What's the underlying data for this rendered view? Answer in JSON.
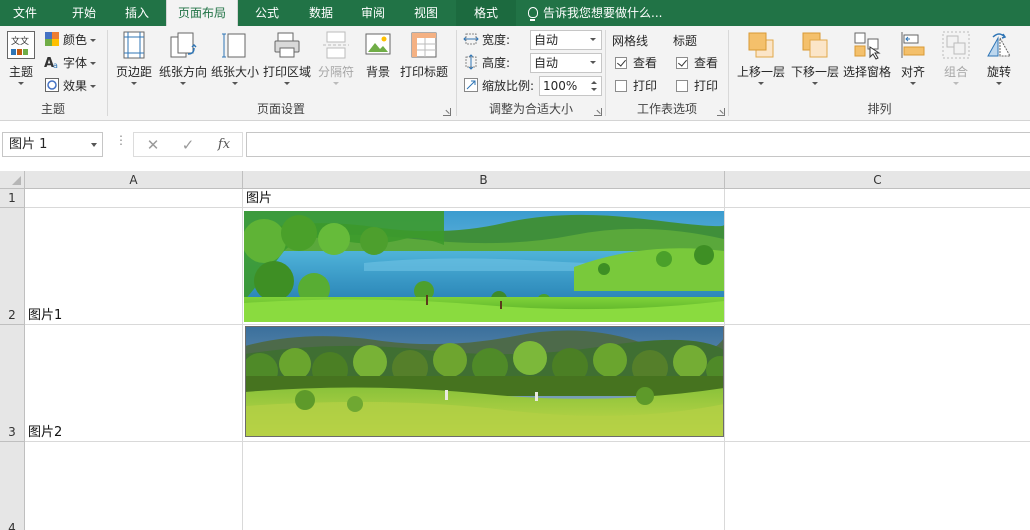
{
  "tabs": [
    {
      "label": "文件"
    },
    {
      "label": "开始"
    },
    {
      "label": "插入"
    },
    {
      "label": "页面布局"
    },
    {
      "label": "公式"
    },
    {
      "label": "数据"
    },
    {
      "label": "审阅"
    },
    {
      "label": "视图"
    },
    {
      "label": "格式"
    }
  ],
  "tell_me": "告诉我您想要做什么...",
  "ribbon": {
    "themes": {
      "theme_label": "主题",
      "colors_label": "颜色",
      "fonts_label": "字体",
      "effects_label": "效果",
      "group_label": "主题"
    },
    "page_setup": {
      "margins_label": "页边距",
      "orientation_label": "纸张方向",
      "size_label": "纸张大小",
      "print_area_label": "打印区域",
      "breaks_label": "分隔符",
      "background_label": "背景",
      "print_titles_label": "打印标题",
      "group_label": "页面设置"
    },
    "scale": {
      "width_label": "宽度:",
      "width_value": "自动",
      "height_label": "高度:",
      "height_value": "自动",
      "scale_label": "缩放比例:",
      "scale_value": "100%",
      "group_label": "调整为合适大小"
    },
    "sheet_options": {
      "gridlines_label": "网格线",
      "headings_label": "标题",
      "view_label": "查看",
      "print_label": "打印",
      "gridlines_view": true,
      "gridlines_print": false,
      "headings_view": true,
      "headings_print": false,
      "group_label": "工作表选项"
    },
    "arrange": {
      "bring_forward_label": "上移一层",
      "send_backward_label": "下移一层",
      "selection_pane_label": "选择窗格",
      "align_label": "对齐",
      "group_objects_label": "组合",
      "rotate_label": "旋转",
      "group_label": "排列"
    }
  },
  "formula_bar": {
    "name_box": "图片 1",
    "cancel_symbol": "✕",
    "enter_symbol": "✓",
    "fx_symbol": "fx",
    "formula": ""
  },
  "sheet": {
    "columns": [
      "A",
      "B",
      "C"
    ],
    "rows": [
      "1",
      "2",
      "3",
      "4"
    ],
    "cells": {
      "B1": "图片",
      "A2": "图片1",
      "A3": "图片2"
    },
    "pictures": [
      {
        "name": "landscape-lake-picture",
        "scene": "lake with green hills and trees"
      },
      {
        "name": "landscape-forest-picture",
        "scene": "green meadow with forest and mountains"
      }
    ]
  },
  "colors": {
    "excel_green": "#217346",
    "ribbon_bg": "#f3f3f3",
    "header_bg": "#e6e6e6",
    "gridline": "#d9d9d9"
  }
}
